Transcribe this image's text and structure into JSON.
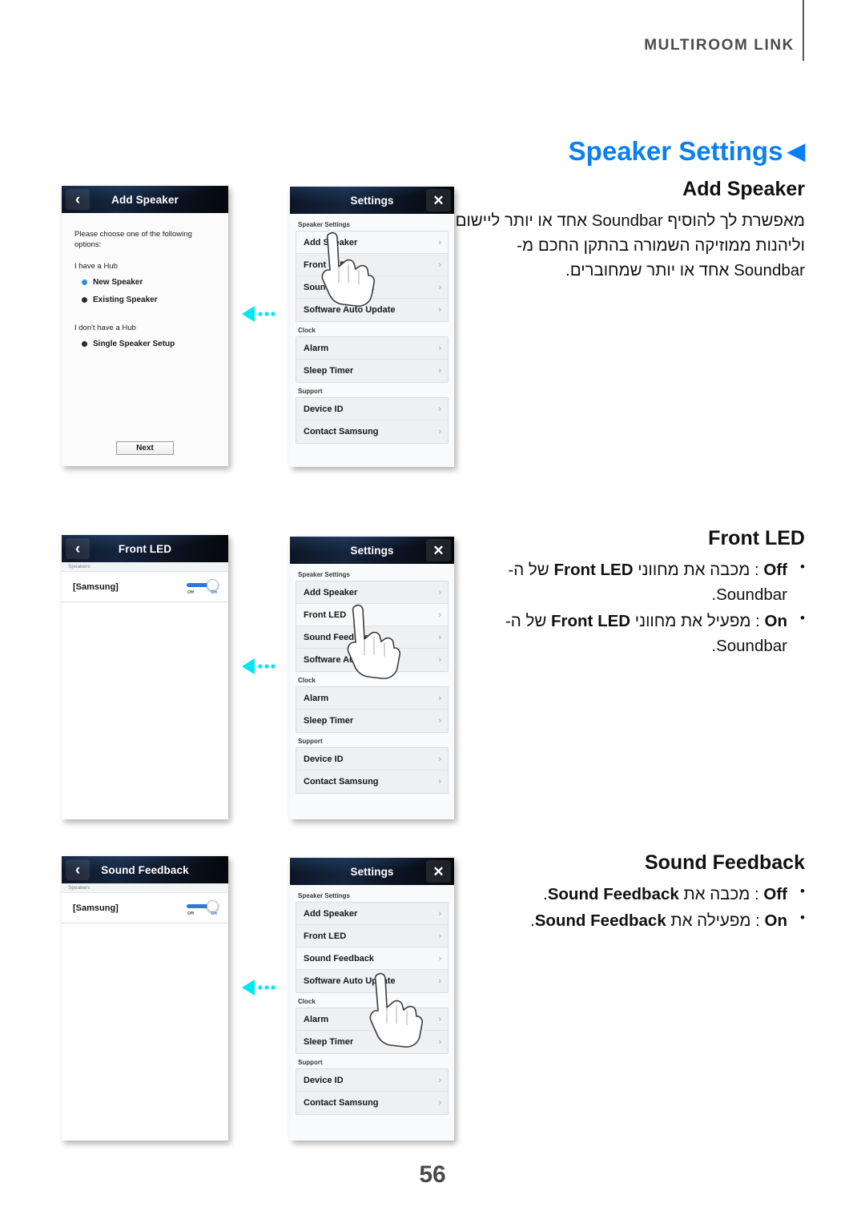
{
  "header": {
    "running_head": "MULTIROOM LINK",
    "page_number": "56"
  },
  "chapter": {
    "title": "Speaker Settings",
    "caret": "◀",
    "accent_color": "#0A7FF4"
  },
  "sections": [
    {
      "heading": "Add Speaker",
      "paragraph": "מאפשרת לך להוסיף Soundbar אחד או יותר ליישום וליהנות ממוזיקה השמורה בהתקן החכם מ-Soundbar אחד או יותר שמחוברים."
    },
    {
      "heading": "Front LED",
      "bullets": [
        "Off : מכבה את מחווני Front LED של ה-Soundbar.",
        "On : מפעיל את מחווני Front LED של ה-Soundbar."
      ],
      "bullets_rich": [
        {
          "state": "Off",
          "sep": " : ",
          "he_a": "מכבה את מחווני ",
          "term": "Front LED",
          "he_b": " של ה-Soundbar."
        },
        {
          "state": "On",
          "sep": " : ",
          "he_a": "מפעיל את מחווני ",
          "term": "Front LED",
          "he_b": " של ה-Soundbar."
        }
      ]
    },
    {
      "heading": "Sound Feedback",
      "bullets": [
        "Off : מכבה את Sound Feedback.",
        "On : מפעילה את Sound Feedback."
      ],
      "bullets_rich": [
        {
          "state": "Off",
          "sep": " : ",
          "he_a": "מכבה את ",
          "term": "Sound Feedback",
          "he_b": "."
        },
        {
          "state": "On",
          "sep": " : ",
          "he_a": "מפעילה את ",
          "term": "Sound Feedback",
          "he_b": "."
        }
      ]
    }
  ],
  "screens": {
    "add_speaker": {
      "title": "Add Speaker",
      "back_icon": "‹",
      "lead": "Please choose one of the following options:",
      "group_hub": "I have a Hub",
      "options_hub": [
        {
          "label": "New Speaker",
          "selected": true
        },
        {
          "label": "Existing Speaker",
          "selected": false
        }
      ],
      "group_nohub": "I don't have a Hub",
      "options_nohub": [
        {
          "label": "Single Speaker Setup",
          "selected": false
        }
      ],
      "next_label": "Next"
    },
    "front_led": {
      "title": "Front LED",
      "back_icon": "‹",
      "section_label": "Speakers",
      "device_name": "[Samsung]",
      "toggle": {
        "off_label": "Off",
        "on_label": "On",
        "value": "On",
        "accent": "#2F78D6"
      }
    },
    "sound_feedback": {
      "title": "Sound Feedback",
      "back_icon": "‹",
      "section_label": "Speakers",
      "device_name": "[Samsung]",
      "toggle": {
        "off_label": "Off",
        "on_label": "On",
        "value": "On",
        "accent": "#2F78D6"
      }
    },
    "settings": {
      "title": "Settings",
      "close_icon": "✕",
      "groups": [
        {
          "label": "Speaker Settings",
          "rows": [
            "Add Speaker",
            "Front LED",
            "Sound Feedback",
            "Software Auto Update"
          ]
        },
        {
          "label": "Clock",
          "rows": [
            "Alarm",
            "Sleep Timer"
          ]
        },
        {
          "label": "Support",
          "rows": [
            "Device ID",
            "Contact Samsung"
          ]
        }
      ],
      "chevron": "›",
      "highlighted": [
        "Add Speaker",
        "Front LED",
        "Sound Feedback"
      ]
    }
  },
  "flow_arrow": {
    "glyph": "◀",
    "dots": 3,
    "color": "#00E8F0"
  }
}
